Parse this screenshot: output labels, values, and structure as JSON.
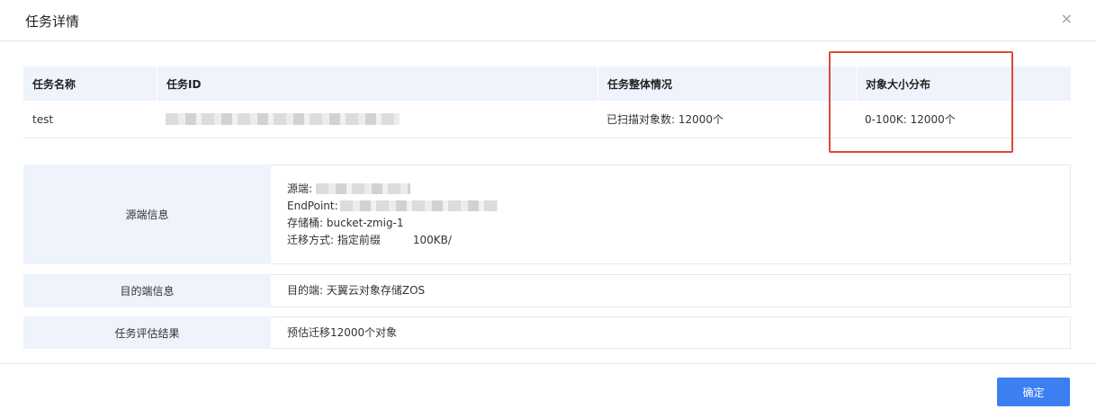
{
  "dialog": {
    "title": "任务详情",
    "close_icon": "×"
  },
  "table": {
    "headers": [
      "任务名称",
      "任务ID",
      "任务整体情况",
      "对象大小分布"
    ],
    "row": {
      "name": "test",
      "id": "",
      "overall": "已扫描对象数: 12000个",
      "distribution": "0-100K: 12000个"
    }
  },
  "source": {
    "label": "源端信息",
    "endpoint_type_label": "源端:",
    "endpoint_label": "EndPoint:",
    "bucket": "存储桶: bucket-zmig-1",
    "method_label": "迁移方式: 指定前缀",
    "method_size": "100KB/"
  },
  "destination": {
    "label": "目的端信息",
    "value": "目的端: 天翼云对象存储ZOS"
  },
  "evaluation": {
    "label": "任务评估结果",
    "value": "预估迁移12000个对象"
  },
  "footer": {
    "ok_label": "确定"
  },
  "colors": {
    "accent": "#3b7ff0",
    "header_bg": "#eef3fc",
    "highlight": "#e0473c"
  }
}
